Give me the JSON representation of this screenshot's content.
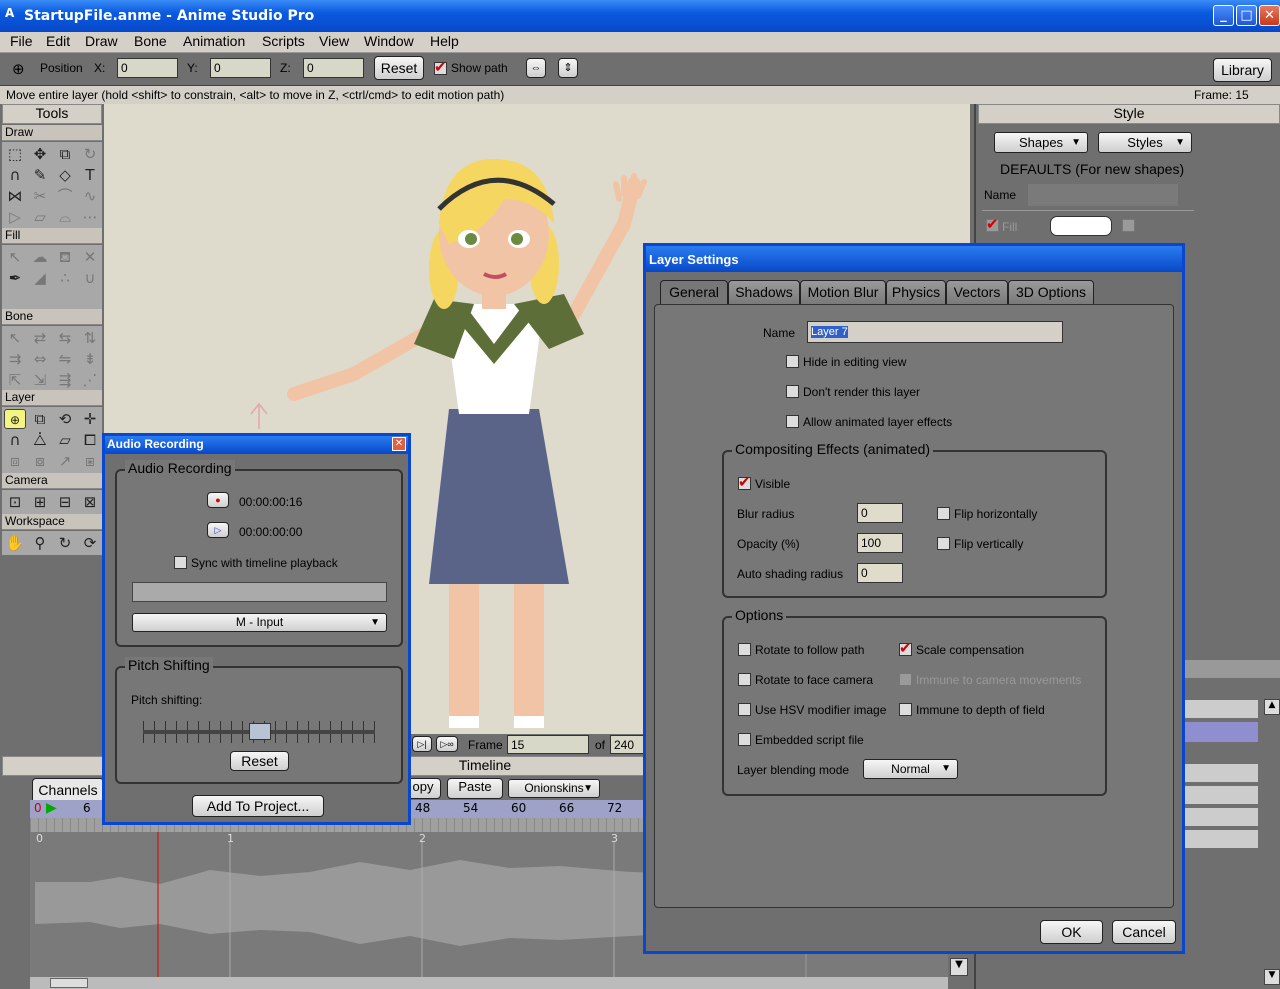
{
  "window": {
    "title": "StartupFile.anme - Anime Studio Pro",
    "min": "_",
    "max": "□",
    "close": "✕"
  },
  "menu": [
    "File",
    "Edit",
    "Draw",
    "Bone",
    "Animation",
    "Scripts",
    "View",
    "Window",
    "Help"
  ],
  "toolbar": {
    "position_label": "Position",
    "x_label": "X:",
    "x_value": "0",
    "y_label": "Y:",
    "y_value": "0",
    "z_label": "Z:",
    "z_value": "0",
    "reset": "Reset",
    "show_path": "Show path",
    "library": "Library"
  },
  "status": {
    "hint": "Move entire layer (hold <shift> to constrain, <alt> to move in Z, <ctrl/cmd> to edit motion path)",
    "frame": "Frame: 15"
  },
  "tools": {
    "title": "Tools",
    "sections": [
      "Draw",
      "Fill",
      "Bone",
      "Layer",
      "Camera",
      "Workspace"
    ]
  },
  "style": {
    "title": "Style",
    "shapes": "Shapes",
    "styles": "Styles",
    "defaults": "DEFAULTS (For new shapes)",
    "name_label": "Name",
    "fill_label": "Fill"
  },
  "timeline": {
    "title": "Timeline",
    "channels": "Channels",
    "copy": "opy",
    "paste": "Paste",
    "onionskins": "Onionskins",
    "frame_label": "Frame",
    "frame_value": "15",
    "of_label": "of",
    "total": "240",
    "ruler": [
      "0",
      "6",
      "48",
      "54",
      "60",
      "66",
      "72"
    ],
    "audio_marks": [
      "0",
      "1",
      "2",
      "3"
    ]
  },
  "audio": {
    "title": "Audio Recording",
    "group": "Audio Recording",
    "rec_time": "00:00:00:16",
    "play_time": "00:00:00:00",
    "sync": "Sync with timeline playback",
    "input": "M - Input",
    "pitch_group": "Pitch Shifting",
    "pitch_label": "Pitch shifting:",
    "reset": "Reset",
    "add": "Add To Project..."
  },
  "layer": {
    "title": "Layer Settings",
    "tabs": [
      "General",
      "Shadows",
      "Motion Blur",
      "Physics",
      "Vectors",
      "3D Options"
    ],
    "name_label": "Name",
    "name_value": "Layer 7",
    "hide": "Hide in editing view",
    "dont_render": "Don't render this layer",
    "allow_anim": "Allow animated layer effects",
    "comp_group": "Compositing Effects (animated)",
    "visible": "Visible",
    "blur_label": "Blur radius",
    "blur_value": "0",
    "opacity_label": "Opacity (%)",
    "opacity_value": "100",
    "auto_label": "Auto shading radius",
    "auto_value": "0",
    "flip_h": "Flip horizontally",
    "flip_v": "Flip vertically",
    "opt_group": "Options",
    "rotate_path": "Rotate to follow path",
    "scale_comp": "Scale compensation",
    "rotate_cam": "Rotate to face camera",
    "immune_cam": "Immune to camera movements",
    "hsv": "Use HSV modifier image",
    "immune_dof": "Immune to depth of field",
    "embedded": "Embedded script file",
    "blend_label": "Layer blending mode",
    "blend_value": "Normal",
    "ok": "OK",
    "cancel": "Cancel"
  }
}
